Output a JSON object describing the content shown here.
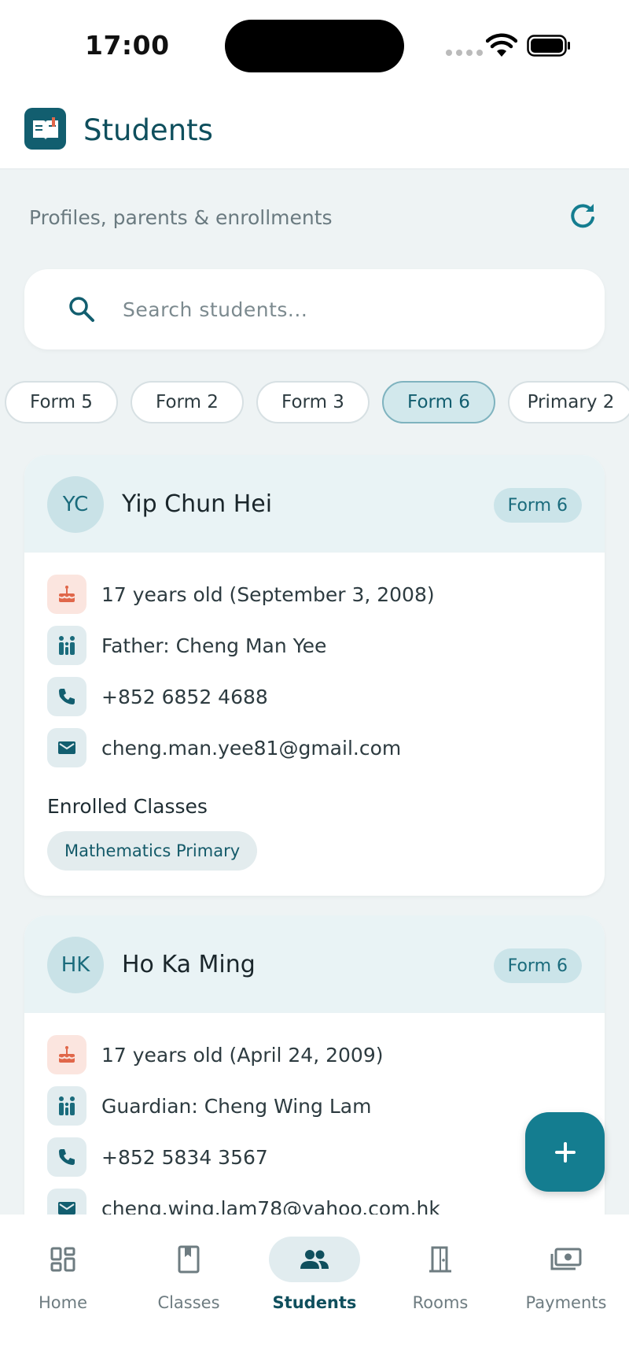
{
  "status_bar": {
    "time": "17:00"
  },
  "header": {
    "title": "Students"
  },
  "subtitle": "Profiles, parents & enrollments",
  "search": {
    "placeholder": "Search students..."
  },
  "filters": [
    {
      "label": "Form 5",
      "active": false
    },
    {
      "label": "Form 2",
      "active": false
    },
    {
      "label": "Form 3",
      "active": false
    },
    {
      "label": "Form 6",
      "active": true
    },
    {
      "label": "Primary 2",
      "active": false
    }
  ],
  "students": [
    {
      "initials": "YC",
      "name": "Yip Chun Hei",
      "form": "Form 6",
      "age": "17 years old (September 3, 2008)",
      "parent": "Father: Cheng Man Yee",
      "phone": "+852 6852 4688",
      "email": "cheng.man.yee81@gmail.com",
      "enrolled_label": "Enrolled Classes",
      "classes": [
        "Mathematics Primary"
      ]
    },
    {
      "initials": "HK",
      "name": "Ho Ka Ming",
      "form": "Form 6",
      "age": "17 years old (April 24, 2009)",
      "parent": "Guardian: Cheng Wing Lam",
      "phone": "+852 5834 3567",
      "email": "cheng.wing.lam78@yahoo.com.hk"
    }
  ],
  "nav": [
    {
      "label": "Home",
      "icon": "dashboard-icon",
      "active": false
    },
    {
      "label": "Classes",
      "icon": "book-icon",
      "active": false
    },
    {
      "label": "Students",
      "icon": "people-icon",
      "active": true
    },
    {
      "label": "Rooms",
      "icon": "door-icon",
      "active": false
    },
    {
      "label": "Payments",
      "icon": "payments-icon",
      "active": false
    }
  ],
  "colors": {
    "primary": "#125e6f",
    "accent": "#147d90",
    "background": "#eef3f4"
  }
}
